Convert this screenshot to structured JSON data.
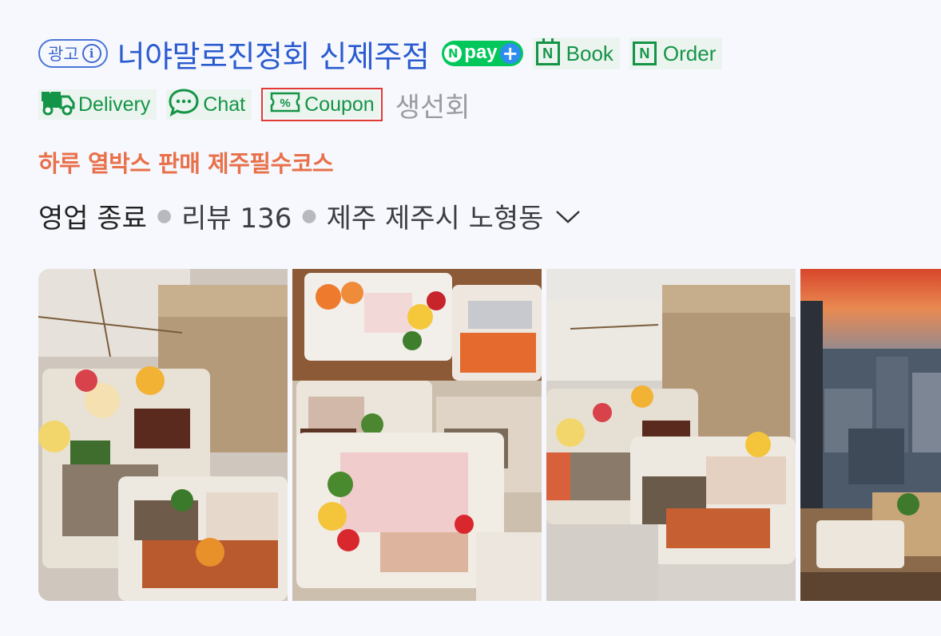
{
  "ad": {
    "label": "광고",
    "info": "i"
  },
  "title": "너야말로진정회 신제주점",
  "badges": {
    "npay": "pay",
    "book": "Book",
    "order": "Order",
    "delivery": "Delivery",
    "chat": "Chat",
    "coupon": "Coupon",
    "n_letter": "N"
  },
  "category": "생선회",
  "promo": "하루 열박스 판매 제주필수코스",
  "status": {
    "business": "영업 종료",
    "reviews": "리뷰 136",
    "location": "제주 제주시 노형동"
  },
  "colors": {
    "brand_green": "#03c75a",
    "badge_green": "#149447",
    "title_blue": "#2b5bd0",
    "promo_orange": "#e8704a",
    "coupon_highlight": "#e23b33"
  },
  "photos": [
    "photo-sashimi-box-1",
    "photo-sashimi-box-2",
    "photo-sashimi-box-3",
    "photo-city-view"
  ]
}
